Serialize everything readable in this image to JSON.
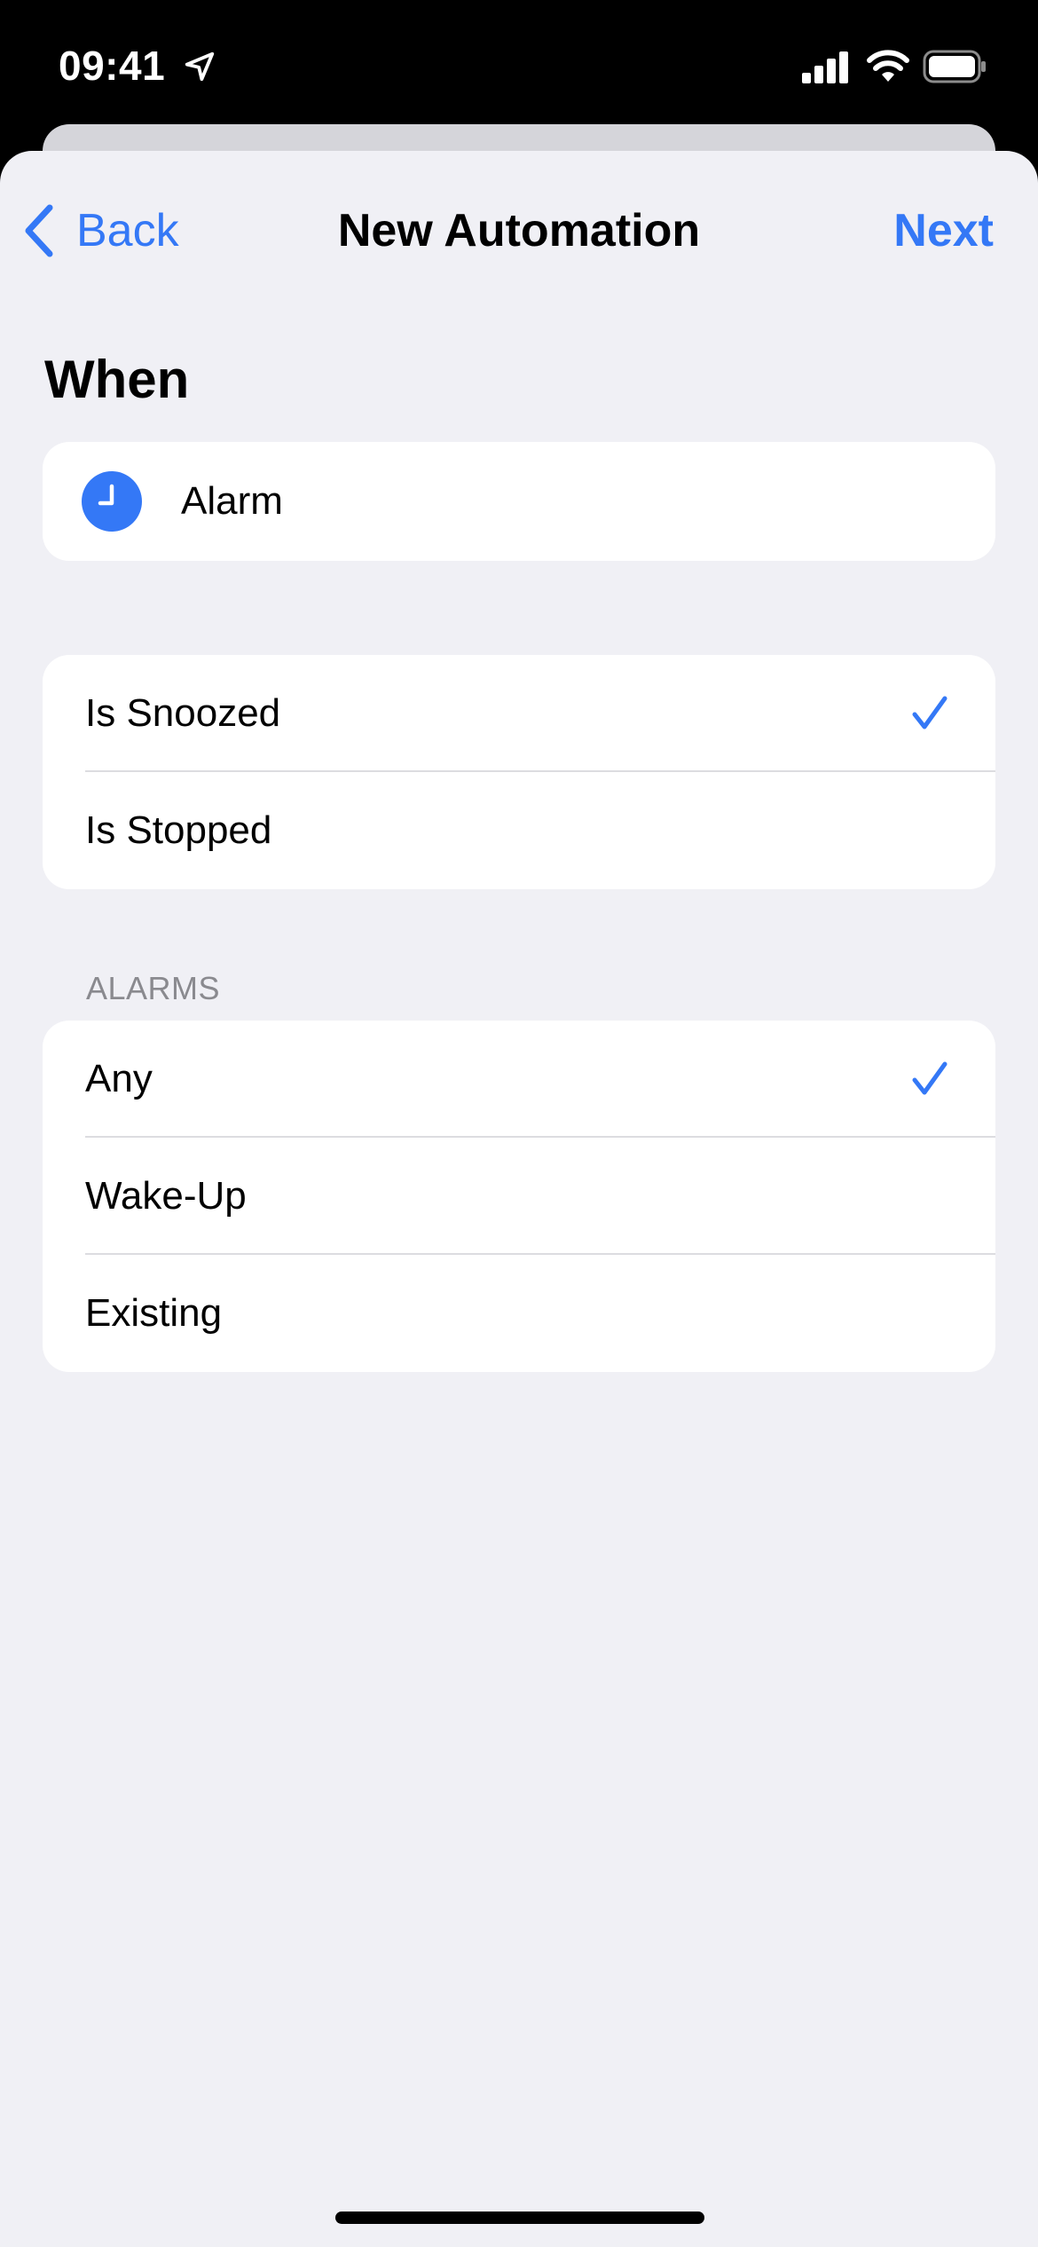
{
  "status_bar": {
    "time": "09:41",
    "icons": [
      "location-arrow-icon",
      "cellular-signal-icon",
      "wifi-icon",
      "battery-icon"
    ]
  },
  "nav": {
    "back_label": "Back",
    "title": "New Automation",
    "next_label": "Next"
  },
  "when": {
    "header": "When",
    "trigger": {
      "icon": "alarm-clock-icon",
      "label": "Alarm"
    }
  },
  "events": {
    "items": [
      {
        "label": "Is Snoozed",
        "selected": true
      },
      {
        "label": "Is Stopped",
        "selected": false
      }
    ]
  },
  "alarms": {
    "header": "ALARMS",
    "items": [
      {
        "label": "Any",
        "selected": true
      },
      {
        "label": "Wake-Up",
        "selected": false
      },
      {
        "label": "Existing",
        "selected": false
      }
    ]
  },
  "colors": {
    "accent": "#3478f6",
    "background": "#f0f0f5",
    "card": "#ffffff",
    "secondary_text": "#8a8a8f"
  }
}
